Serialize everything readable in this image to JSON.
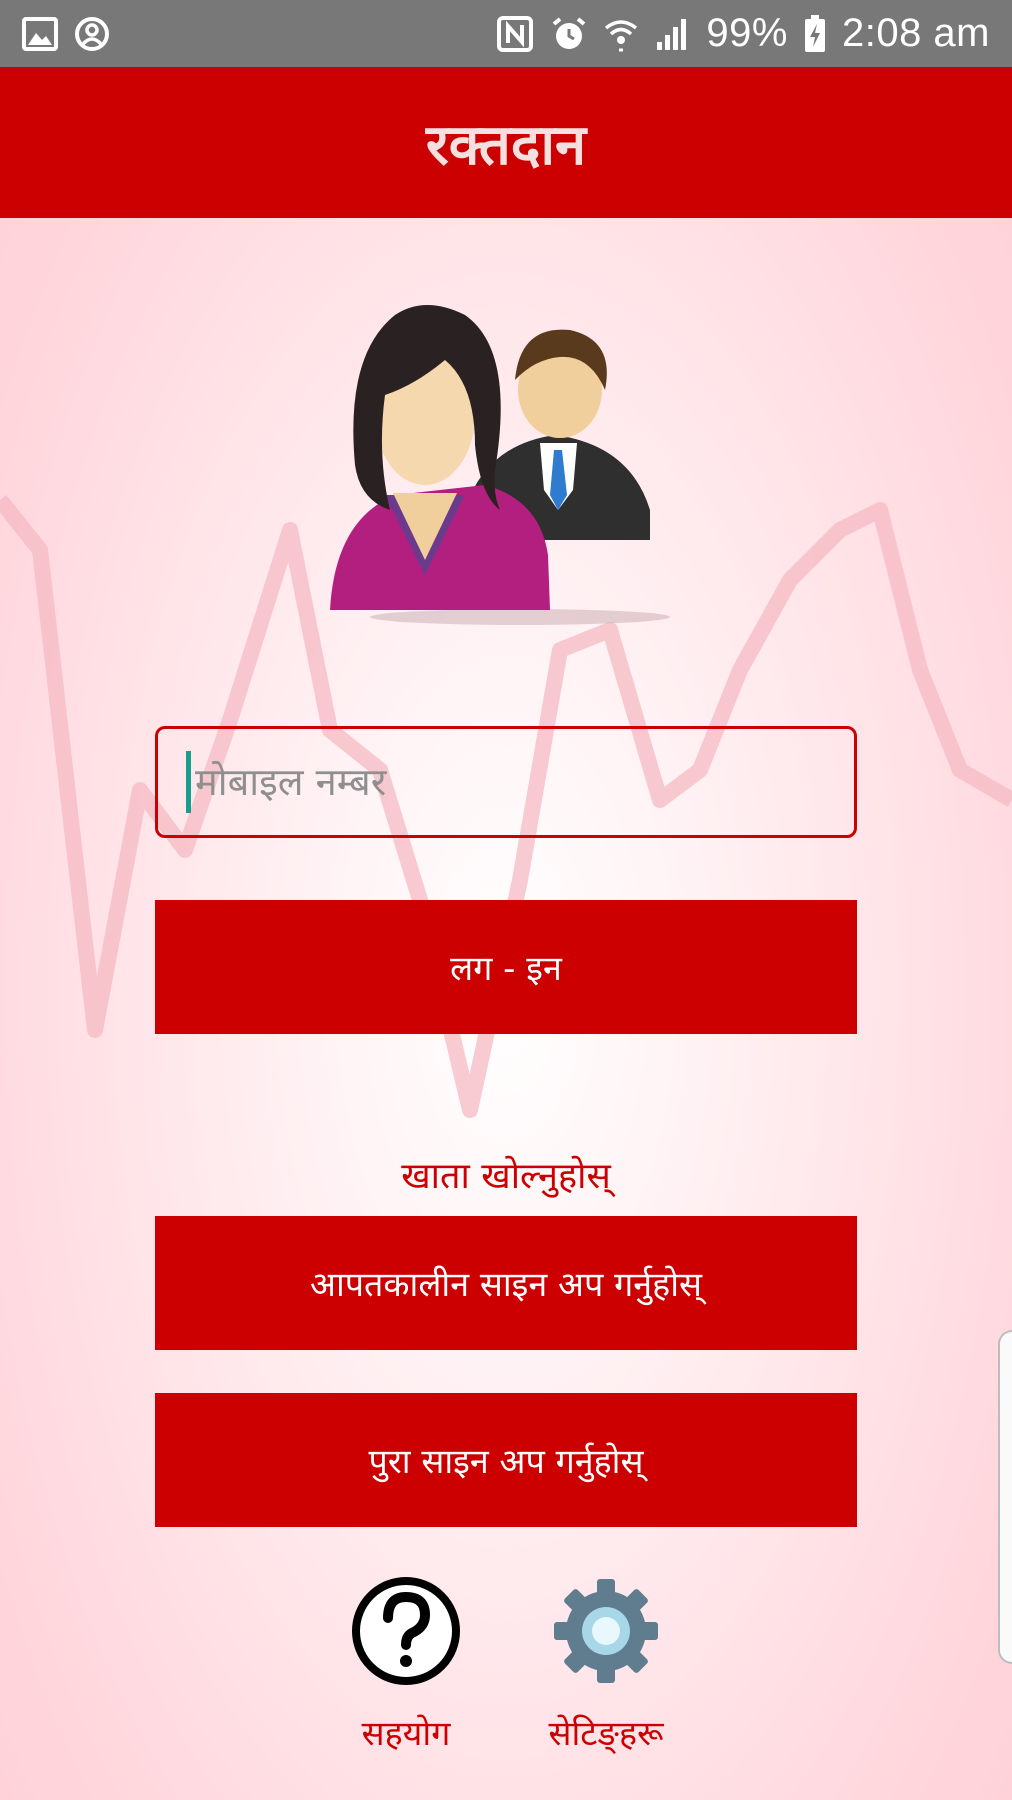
{
  "status_bar": {
    "battery": "99%",
    "time": "2:08 am",
    "icons": [
      "image-icon",
      "account-circle-icon",
      "nfc-icon",
      "alarm-icon",
      "wifi-icon",
      "signal-icon",
      "battery-charging-icon"
    ]
  },
  "app_bar": {
    "title": "रक्तदान"
  },
  "login": {
    "mobile_placeholder": "मोबाइल नम्बर",
    "mobile_value": "",
    "login_button": "लग - इन"
  },
  "signup": {
    "open_account_label": "खाता खोल्नुहोस्",
    "emergency_signup_button": "आपतकालीन साइन अप गर्नुहोस्",
    "full_signup_button": "पुरा साइन अप गर्नुहोस्"
  },
  "bottom": {
    "help_label": "सहयोग",
    "help_icon": "help-circle-icon",
    "settings_label": "सेटिङ्हरू",
    "settings_icon": "gear-icon"
  },
  "colors": {
    "primary": "#cc0000",
    "status_bar": "#787878",
    "cursor": "#1a9c8a"
  }
}
